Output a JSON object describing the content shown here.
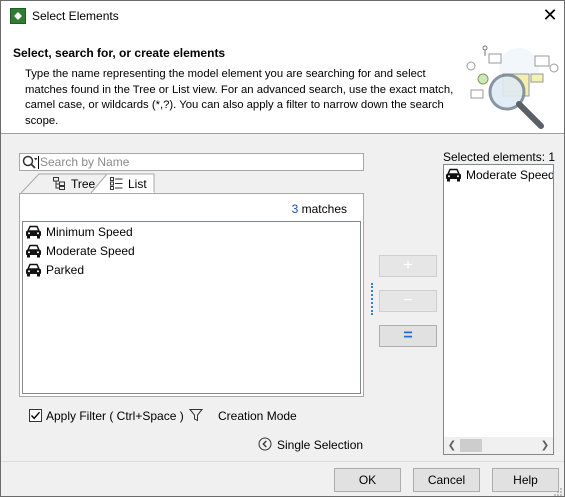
{
  "window": {
    "title": "Select Elements",
    "close_glyph": "✕"
  },
  "banner": {
    "title": "Select, search for, or create elements",
    "description": "Type the name representing the model element you are searching for and select matches found in the Tree or List view. For an advanced search, use the exact match, camel case, or wildcards (*,?). You can also apply a filter to narrow down the search scope."
  },
  "search": {
    "placeholder": "Search by Name",
    "value": ""
  },
  "tabs": [
    {
      "label": "Tree",
      "icon": "tree-icon",
      "active": false
    },
    {
      "label": "List",
      "icon": "list-icon",
      "active": true
    }
  ],
  "results": {
    "match_count": "3",
    "match_label": "matches",
    "items": [
      {
        "label": "Minimum Speed",
        "icon": "car-icon"
      },
      {
        "label": "Moderate Speed",
        "icon": "car-icon"
      },
      {
        "label": "Parked",
        "icon": "car-icon"
      }
    ]
  },
  "transfer_buttons": {
    "add": "+",
    "remove": "−",
    "remove_all": "="
  },
  "selected": {
    "label": "Selected elements: 1",
    "items": [
      {
        "label": "Moderate Speed",
        "icon": "car-icon"
      }
    ]
  },
  "options": {
    "apply_filter_label": "Apply Filter ( Ctrl+Space )",
    "apply_filter_checked": true,
    "creation_mode_label": "Creation Mode",
    "single_selection_label": "Single Selection"
  },
  "footer": {
    "ok": "OK",
    "cancel": "Cancel",
    "help": "Help"
  },
  "colors": {
    "match_count": "#1f4fb5",
    "remove_all": "#1f6fd0",
    "app_icon": "#2f7d32"
  }
}
